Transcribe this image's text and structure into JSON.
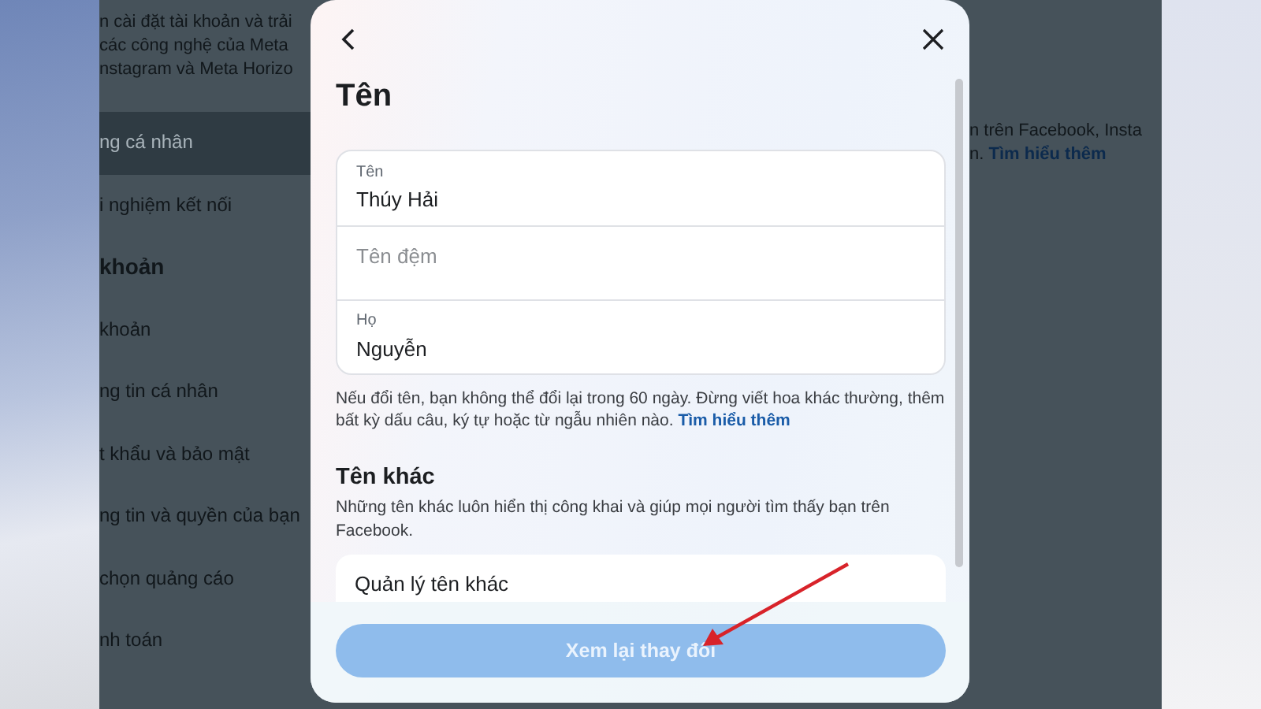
{
  "background_page": {
    "intro_lines": [
      "n cài đặt tài khoản và trải",
      "các công nghệ của Meta",
      "nstagram và Meta Horizo"
    ],
    "menu_items": [
      {
        "label": "ng cá nhân",
        "kind": "item",
        "selected": true
      },
      {
        "label": "i nghiệm kết nối",
        "kind": "item",
        "selected": false
      },
      {
        "label": "khoản",
        "kind": "heading",
        "selected": false
      },
      {
        "label": "khoản",
        "kind": "item",
        "selected": false
      },
      {
        "label": "ng tin cá nhân",
        "kind": "item",
        "selected": false
      },
      {
        "label": "t khẩu và bảo mật",
        "kind": "item",
        "selected": false
      },
      {
        "label": "ng tin và quyền của bạn",
        "kind": "item",
        "selected": false
      },
      {
        "label": "chọn quảng cáo",
        "kind": "item",
        "selected": false
      },
      {
        "label": "nh toán",
        "kind": "item",
        "selected": false
      }
    ],
    "right_lines": [
      {
        "text": "n trên Facebook, Insta"
      },
      {
        "text": "n.",
        "link": "Tìm hiểu thêm"
      }
    ]
  },
  "modal": {
    "title": "Tên",
    "fields": [
      {
        "label": "Tên",
        "value": "Thúy Hải"
      },
      {
        "placeholder": "Tên đệm"
      },
      {
        "label": "Họ",
        "value": "Nguyễn"
      }
    ],
    "notice": {
      "text": "Nếu đổi tên, bạn không thể đổi lại trong 60 ngày. Đừng viết hoa khác thường, thêm bất kỳ dấu câu, ký tự hoặc từ ngẫu nhiên nào.",
      "link": "Tìm hiểu thêm"
    },
    "section_title": "Tên khác",
    "section_description": "Những tên khác luôn hiển thị công khai và giúp mọi người tìm thấy bạn trên Facebook.",
    "manage_item": "Quản lý tên khác",
    "submit_button": {
      "label": "Xem lại thay đổi",
      "disabled": true
    }
  }
}
